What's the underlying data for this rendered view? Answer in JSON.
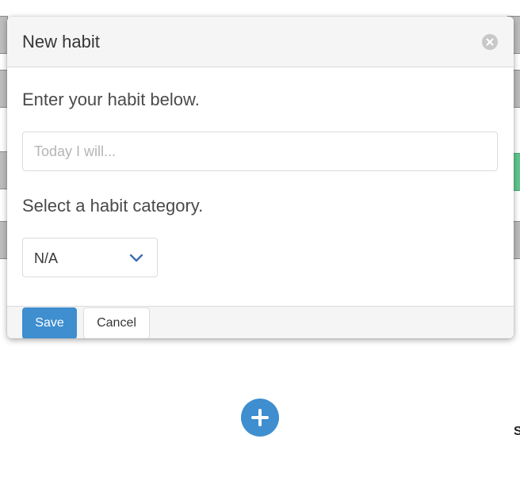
{
  "modal": {
    "title": "New habit",
    "close_icon": "close-circle-icon",
    "habit_prompt": "Enter your habit below.",
    "habit_input": {
      "value": "",
      "placeholder": "Today I will..."
    },
    "category_prompt": "Select a habit category.",
    "category_select": {
      "selected": "N/A",
      "icon": "chevron-down-icon"
    },
    "footer": {
      "save_label": "Save",
      "cancel_label": "Cancel"
    }
  },
  "background": {
    "corner_letter": "S"
  },
  "add_button": {
    "icon": "plus-icon"
  },
  "colors": {
    "primary": "#3e8ed0",
    "header_bg": "#f5f5f5",
    "accent_green": "#5fc88e"
  }
}
